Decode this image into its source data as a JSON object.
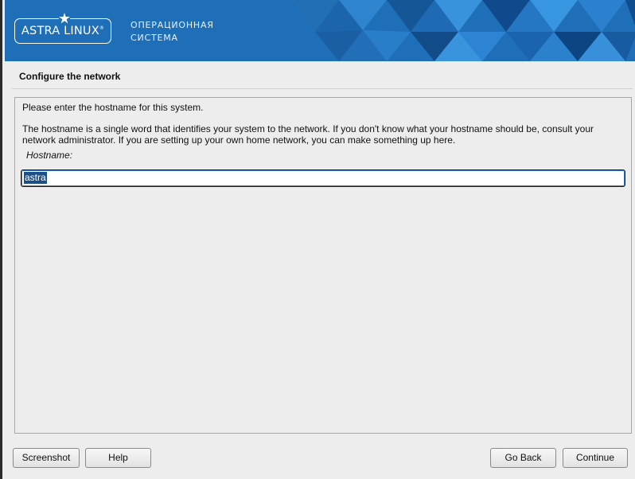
{
  "banner": {
    "logo_text": "ASTRA LINUX",
    "logo_registered": "®",
    "tagline_line1": "ОПЕРАЦИОННАЯ",
    "tagline_line2": "СИСТЕМА",
    "colors": {
      "primary": "#1f6fb8",
      "light": "#4aa0e6",
      "dark": "#0e4b8a"
    }
  },
  "page": {
    "title": "Configure the network"
  },
  "content": {
    "intro": "Please enter the hostname for this system.",
    "description": "The hostname is a single word that identifies your system to the network. If you don't know what your hostname should be, consult your network administrator. If you are setting up your own home network, you can make something up here.",
    "field_label": "Hostname:",
    "hostname_value": "astra"
  },
  "buttons": {
    "screenshot": "Screenshot",
    "help": "Help",
    "go_back": "Go Back",
    "continue": "Continue"
  }
}
